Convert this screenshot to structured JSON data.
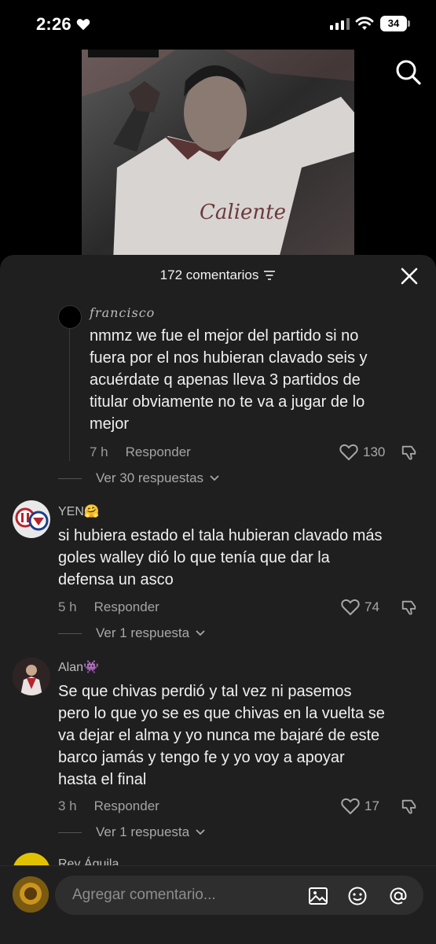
{
  "status_bar": {
    "time": "2:26",
    "battery": "34"
  },
  "comments_header": {
    "title": "172 comentarios"
  },
  "comments": [
    {
      "username": "francisco",
      "text_lines": [
        "nmmz we fue el mejor del partido si no",
        "fuera por el nos hubieran clavado seis y",
        "acuérdate q apenas lleva 3 partidos de",
        "titular obviamente no te va a jugar de lo",
        "mejor"
      ],
      "time": "7 h",
      "reply_label": "Responder",
      "likes": "130",
      "view_replies": "Ver 30 respuestas"
    },
    {
      "username": "YEN🤗",
      "text_lines": [
        "si hubiera estado el tala hubieran clavado más",
        "goles walley dió lo que tenía que dar la",
        "defensa un asco"
      ],
      "time": "5 h",
      "reply_label": "Responder",
      "likes": "74",
      "view_replies": "Ver 1 respuesta"
    },
    {
      "username": "Alan👾",
      "text_lines": [
        "Se que chivas perdió y tal vez ni pasemos",
        "pero lo que yo se es que chivas en la vuelta se",
        "va dejar el alma y yo nunca me bajaré de este",
        "barco jamás y tengo fe y yo voy a apoyar",
        "hasta el final"
      ],
      "time": "3 h",
      "reply_label": "Responder",
      "likes": "17",
      "view_replies": "Ver 1 respuesta"
    },
    {
      "username": "Rey Águila"
    }
  ],
  "input": {
    "placeholder": "Agregar comentario..."
  }
}
